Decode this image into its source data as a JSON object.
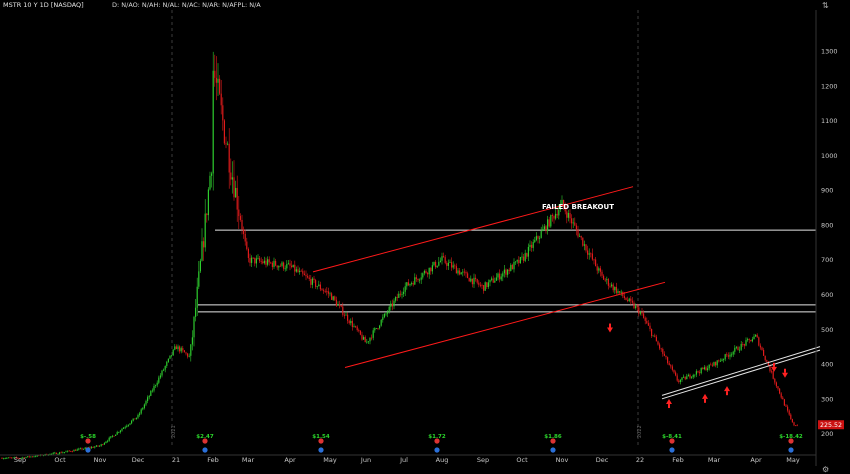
{
  "header": {
    "symbol": "MSTR 10 Y 1D [NASDAQ]",
    "stats": "D: N/AO: N/AH: N/AL: N/AC: N/AR: N/AFPL: N/A"
  },
  "colors": {
    "background": "#000000",
    "up_candle": "#2ecc2e",
    "down_candle": "#e01b1b",
    "channel": "#ff1a1a",
    "level": "#e6e6e6",
    "axis_text": "#c8c8c8",
    "earnings_text": "#2bd52b",
    "last_price_bg": "#cc1111"
  },
  "icons": [
    "earnings-marker-icon",
    "dividend-marker-icon",
    "up-arrow-icon",
    "down-arrow-icon",
    "gear-icon",
    "fit-icon"
  ],
  "chart_data": {
    "type": "candlestick",
    "title": "MSTR 10 Y 1D [NASDAQ]",
    "yscale": "linear",
    "ylim": [
      150,
      1350
    ],
    "y_ticks": [
      200,
      300,
      400,
      500,
      600,
      700,
      800,
      900,
      1000,
      1100,
      1200,
      1300
    ],
    "x_ticks": [
      "Sep",
      "Oct",
      "Nov",
      "Dec",
      "21",
      "Feb",
      "Mar",
      "Apr",
      "May",
      "Jun",
      "Jul",
      "Aug",
      "Sep",
      "Oct",
      "Nov",
      "Dec",
      "22",
      "Feb",
      "Mar",
      "Apr",
      "May"
    ],
    "year_dividers": [
      "2021",
      "2022"
    ],
    "last_price": "225.52",
    "annotation": "FAILED BREAKOUT",
    "earnings": [
      "$-.58",
      "$2.47",
      "$1.54",
      "$1.72",
      "$1.86",
      "$-8.41",
      "$-18.42"
    ],
    "price_path": [
      [
        "Sep",
        130
      ],
      [
        "Oct",
        145
      ],
      [
        "Nov",
        165
      ],
      [
        "Dec",
        250
      ],
      [
        "21",
        450
      ],
      [
        "Feb",
        1250
      ],
      [
        "Mar",
        700
      ],
      [
        "Apr",
        680
      ],
      [
        "May",
        600
      ],
      [
        "Jun",
        460
      ],
      [
        "Jul",
        620
      ],
      [
        "Aug",
        700
      ],
      [
        "Sep",
        620
      ],
      [
        "Oct",
        700
      ],
      [
        "Nov",
        860
      ],
      [
        "Dec",
        650
      ],
      [
        "22",
        550
      ],
      [
        "Feb",
        350
      ],
      [
        "Mar",
        400
      ],
      [
        "Apr",
        480
      ],
      [
        "May",
        225.52
      ]
    ],
    "horizontal_levels": [
      785,
      570,
      550
    ],
    "channel_upper": [
      [
        665,
        910
      ]
    ],
    "channel_lower": [
      [
        390,
        635
      ]
    ],
    "support_band": [
      [
        300,
        440
      ],
      [
        310,
        450
      ]
    ],
    "grid": false,
    "legend": "none"
  }
}
